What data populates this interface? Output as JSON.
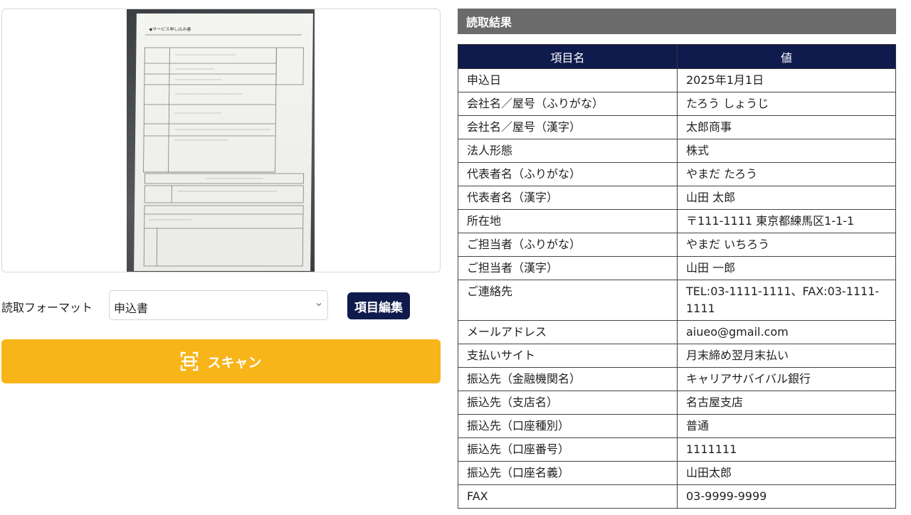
{
  "format": {
    "label": "読取フォーマット",
    "selected": "申込書",
    "edit_button": "項目編集"
  },
  "scan": {
    "label": "スキャン",
    "icon": "scan-frame-icon"
  },
  "result": {
    "header": "読取結果",
    "columns": [
      "項目名",
      "値"
    ],
    "rows": [
      {
        "key": "申込日",
        "value": "2025年1月1日"
      },
      {
        "key": "会社名／屋号（ふりがな）",
        "value": "たろう しょうじ"
      },
      {
        "key": "会社名／屋号（漢字）",
        "value": "太郎商事"
      },
      {
        "key": "法人形態",
        "value": "株式"
      },
      {
        "key": "代表者名（ふりがな）",
        "value": "やまだ たろう"
      },
      {
        "key": "代表者名（漢字）",
        "value": "山田 太郎"
      },
      {
        "key": "所在地",
        "value": "〒111-1111 東京都練馬区1-1-1"
      },
      {
        "key": "ご担当者（ふりがな）",
        "value": "やまだ いちろう"
      },
      {
        "key": "ご担当者（漢字）",
        "value": "山田 一郎"
      },
      {
        "key": "ご連絡先",
        "value": "TEL:03-1111-1111、FAX:03-1111-1111"
      },
      {
        "key": "メールアドレス",
        "value": "aiueo@gmail.com"
      },
      {
        "key": "支払いサイト",
        "value": "月末締め翌月末払い"
      },
      {
        "key": "振込先（金融機関名）",
        "value": "キャリアサバイバル銀行"
      },
      {
        "key": "振込先（支店名）",
        "value": "名古屋支店"
      },
      {
        "key": "振込先（口座種別）",
        "value": "普通"
      },
      {
        "key": "振込先（口座番号）",
        "value": "1111111"
      },
      {
        "key": "振込先（口座名義）",
        "value": "山田太郎"
      },
      {
        "key": "FAX",
        "value": "03-9999-9999"
      }
    ]
  }
}
